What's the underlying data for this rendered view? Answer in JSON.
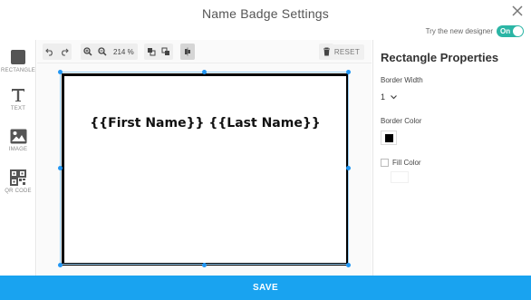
{
  "header": {
    "title": "Name Badge Settings",
    "designer_label": "Try the new designer",
    "designer_toggle": "On"
  },
  "tools": [
    {
      "label": "RECTANGLE",
      "icon": "rectangle-icon"
    },
    {
      "label": "TEXT",
      "icon": "text-icon"
    },
    {
      "label": "IMAGE",
      "icon": "image-icon"
    },
    {
      "label": "QR CODE",
      "icon": "qr-code-icon"
    }
  ],
  "toolbar": {
    "zoom": "214 %",
    "reset_label": "RESET"
  },
  "canvas": {
    "badge_text": "{{First Name}} {{Last Name}}"
  },
  "properties": {
    "title": "Rectangle Properties",
    "border_width_label": "Border Width",
    "border_width_value": "1",
    "border_color_label": "Border Color",
    "border_color": "#000000",
    "fill_color_label": "Fill Color"
  },
  "footer": {
    "save_label": "SAVE"
  },
  "colors": {
    "accent": "#19a3f0",
    "toggle": "#2bb5a5",
    "handle": "#2196f3"
  }
}
